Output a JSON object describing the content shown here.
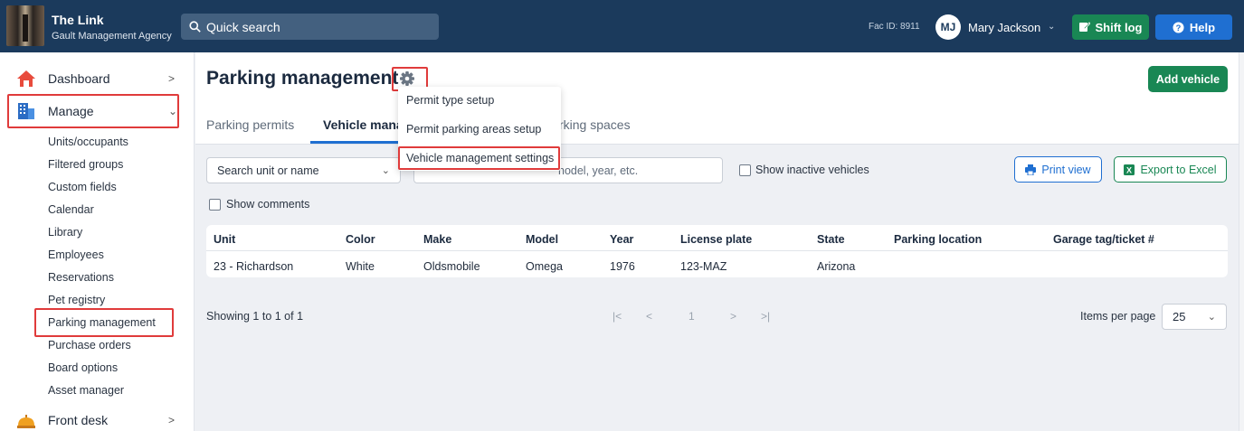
{
  "header": {
    "org_name": "The Link",
    "org_sub": "Gault Management Agency",
    "search_placeholder": "Quick search",
    "fac_id": "Fac ID: 8911",
    "avatar_initials": "MJ",
    "user_name": "Mary Jackson",
    "shift_log_label": "Shift log",
    "help_label": "Help"
  },
  "sidebar": {
    "dashboard_label": "Dashboard",
    "manage_label": "Manage",
    "front_desk_label": "Front desk",
    "manage_items": [
      "Units/occupants",
      "Filtered groups",
      "Custom fields",
      "Calendar",
      "Library",
      "Employees",
      "Reservations",
      "Pet registry",
      "Parking management",
      "Purchase orders",
      "Board options",
      "Asset manager"
    ]
  },
  "page": {
    "title": "Parking management",
    "add_vehicle_label": "Add vehicle",
    "tabs": [
      "Parking permits",
      "Vehicle mana",
      "rking spaces"
    ],
    "settings_menu": [
      "Permit type setup",
      "Permit parking areas setup",
      "Vehicle management settings"
    ],
    "unit_select_placeholder": "Search unit or name",
    "search_placeholder": "nodel, year, etc.",
    "show_inactive_label": "Show inactive vehicles",
    "show_comments_label": "Show comments",
    "print_label": "Print view",
    "export_label": "Export to Excel"
  },
  "table": {
    "columns": [
      "Unit",
      "Color",
      "Make",
      "Model",
      "Year",
      "License plate",
      "State",
      "Parking location",
      "Garage tag/ticket #"
    ],
    "rows": [
      [
        "23 - Richardson",
        "White",
        "Oldsmobile",
        "Omega",
        "1976",
        "123-MAZ",
        "Arizona",
        "",
        ""
      ]
    ]
  },
  "footer": {
    "showing": "Showing 1 to 1 of 1",
    "page_first": "|<",
    "page_prev": "<",
    "current_page": "1",
    "page_next": ">",
    "page_last": ">|",
    "items_per_page_label": "Items per page",
    "items_per_page_value": "25"
  },
  "colors": {
    "topbar": "#1b3a5c",
    "primary": "#1f6fd1",
    "success": "#198754",
    "highlight": "#e03b3b"
  }
}
